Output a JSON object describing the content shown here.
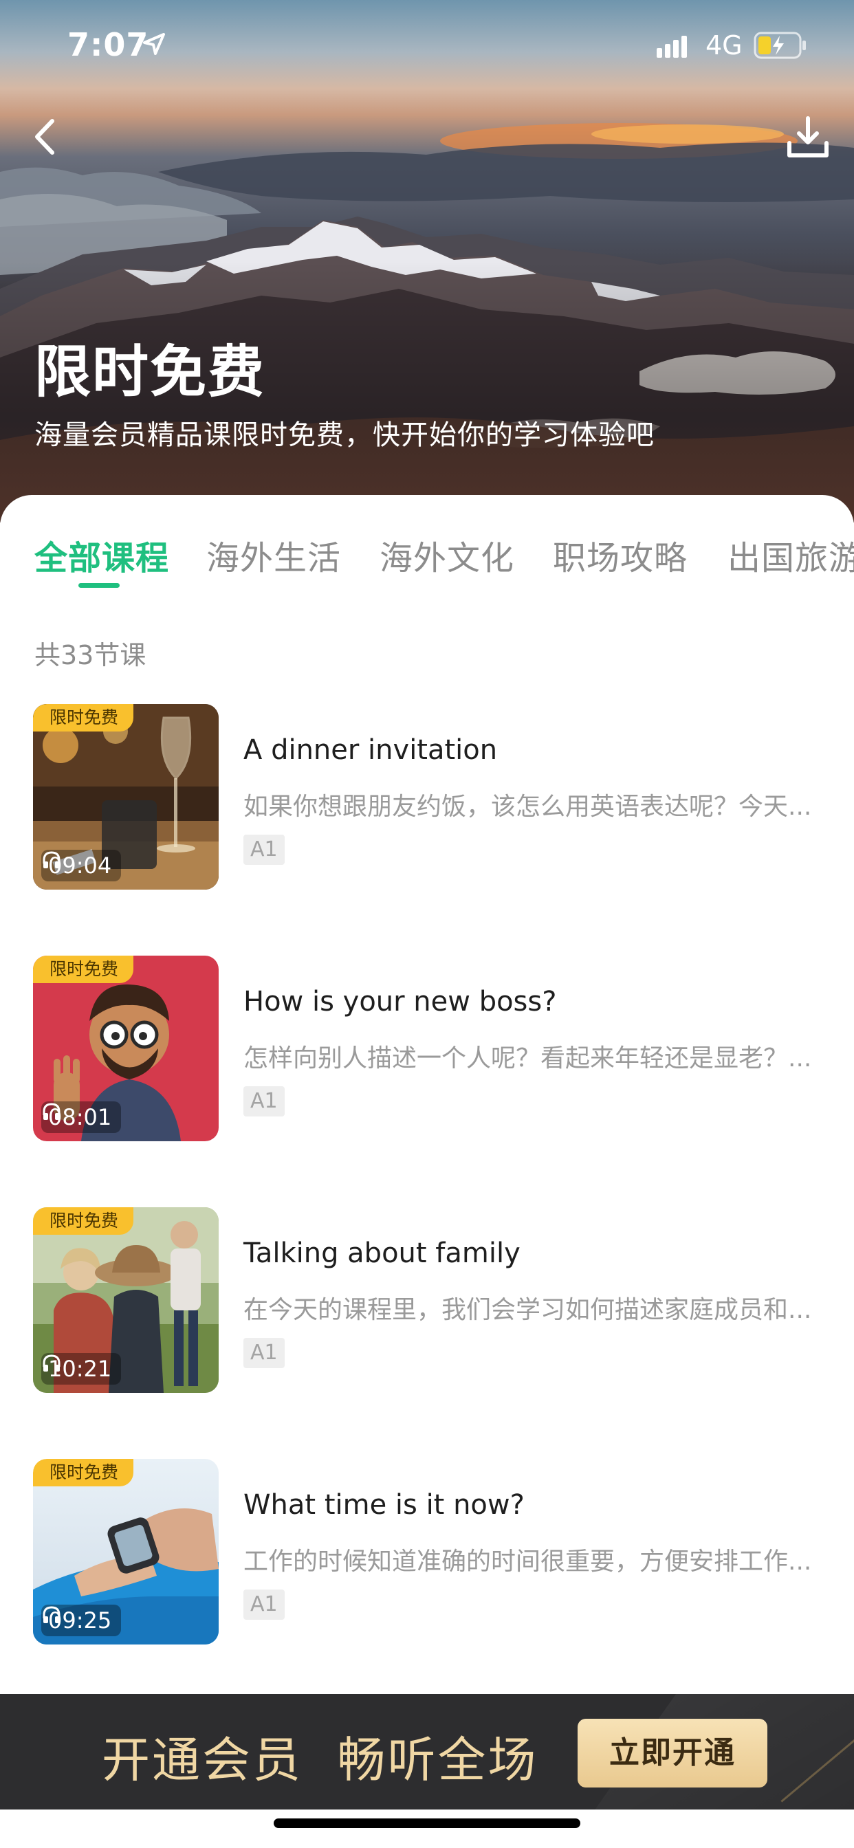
{
  "status_bar": {
    "time": "7:07",
    "network": "4G",
    "icons": [
      "location-arrow-icon",
      "signal-icon",
      "battery-charging-icon"
    ]
  },
  "header": {
    "back_icon": "chevron-left-icon",
    "download_icon": "download-icon",
    "title": "限时免费",
    "subtitle": "海量会员精品课限时免费，快开始你的学习体验吧"
  },
  "tabs": [
    {
      "label": "全部课程",
      "active": true
    },
    {
      "label": "海外生活",
      "active": false
    },
    {
      "label": "海外文化",
      "active": false
    },
    {
      "label": "职场攻略",
      "active": false
    },
    {
      "label": "出国旅游",
      "active": false
    }
  ],
  "course_count": "共33节课",
  "courses": [
    {
      "badge": "限时免费",
      "duration": "09:04",
      "title": "A dinner invitation",
      "description": "如果你想跟朋友约饭，该怎么用英语表达呢？今天...",
      "level": "A1",
      "thumb_icon": "dinner-table-image"
    },
    {
      "badge": "限时免费",
      "duration": "08:01",
      "title": "How is your new boss?",
      "description": "怎样向别人描述一个人呢？看起来年轻还是显老？...",
      "level": "A1",
      "thumb_icon": "cartoon-man-image"
    },
    {
      "badge": "限时免费",
      "duration": "10:21",
      "title": "Talking about family",
      "description": "在今天的课程里，我们会学习如何描述家庭成员和...",
      "level": "A1",
      "thumb_icon": "family-photo-image"
    },
    {
      "badge": "限时免费",
      "duration": "09:25",
      "title": "What time is it now?",
      "description": "工作的时候知道准确的时间很重要，方便安排工作...",
      "level": "A1",
      "thumb_icon": "smartwatch-image"
    }
  ],
  "banner": {
    "text": "开通会员  畅听全场",
    "button": "立即开通"
  },
  "colors": {
    "accent_green": "#1fbf7f",
    "badge_yellow": "#f9c02d",
    "banner_bg": "#2d2d2f",
    "banner_gold": "#f0d7a4"
  }
}
